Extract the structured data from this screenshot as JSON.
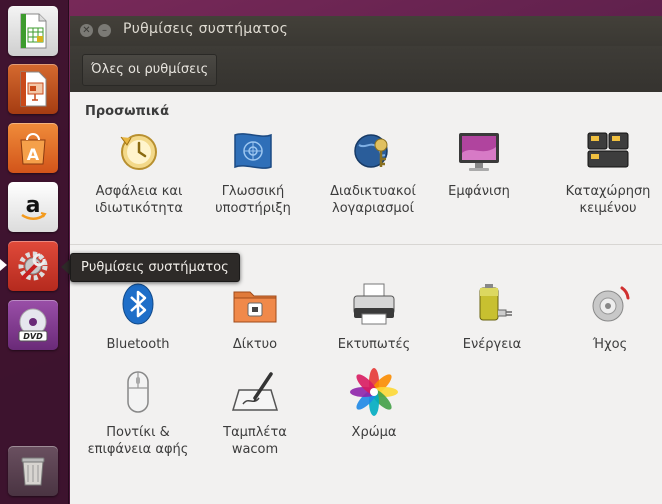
{
  "window": {
    "title": "Ρυθμίσεις συστήματος"
  },
  "toolbar": {
    "all_settings_label": "Όλες οι ρυθμίσεις"
  },
  "tooltip": {
    "text": "Ρυθμίσεις συστήματος"
  },
  "launcher": {
    "items": [
      {
        "icon": "libreoffice-calc-icon"
      },
      {
        "icon": "libreoffice-impress-icon"
      },
      {
        "icon": "software-center-icon"
      },
      {
        "icon": "amazon-icon"
      },
      {
        "icon": "system-settings-icon"
      },
      {
        "icon": "dvd-icon"
      },
      {
        "icon": "trash-icon"
      }
    ]
  },
  "sections": {
    "personal": {
      "title": "Προσωπικά",
      "items": [
        {
          "label": "Ασφάλεια και ιδιωτικότητα",
          "icon": "security-privacy-icon"
        },
        {
          "label": "Γλωσσική υποστήριξη",
          "icon": "language-support-icon"
        },
        {
          "label": "Διαδικτυακοί λογαριασμοί",
          "icon": "online-accounts-icon"
        },
        {
          "label": "Εμφάνιση",
          "icon": "appearance-icon"
        },
        {
          "label": "Καταχώρηση κειμένου",
          "icon": "text-entry-icon"
        }
      ]
    },
    "hardware": {
      "items": [
        {
          "label": "Bluetooth",
          "icon": "bluetooth-icon"
        },
        {
          "label": "Δίκτυο",
          "icon": "network-icon"
        },
        {
          "label": "Εκτυπωτές",
          "icon": "printer-icon"
        },
        {
          "label": "Ενέργεια",
          "icon": "power-icon"
        },
        {
          "label": "Ήχος",
          "icon": "sound-icon"
        },
        {
          "label": "Ποντίκι & επιφάνεια αφής",
          "icon": "mouse-touchpad-icon"
        },
        {
          "label": "Ταμπλέτα wacom",
          "icon": "wacom-tablet-icon"
        },
        {
          "label": "Χρώμα",
          "icon": "color-icon"
        }
      ]
    }
  }
}
